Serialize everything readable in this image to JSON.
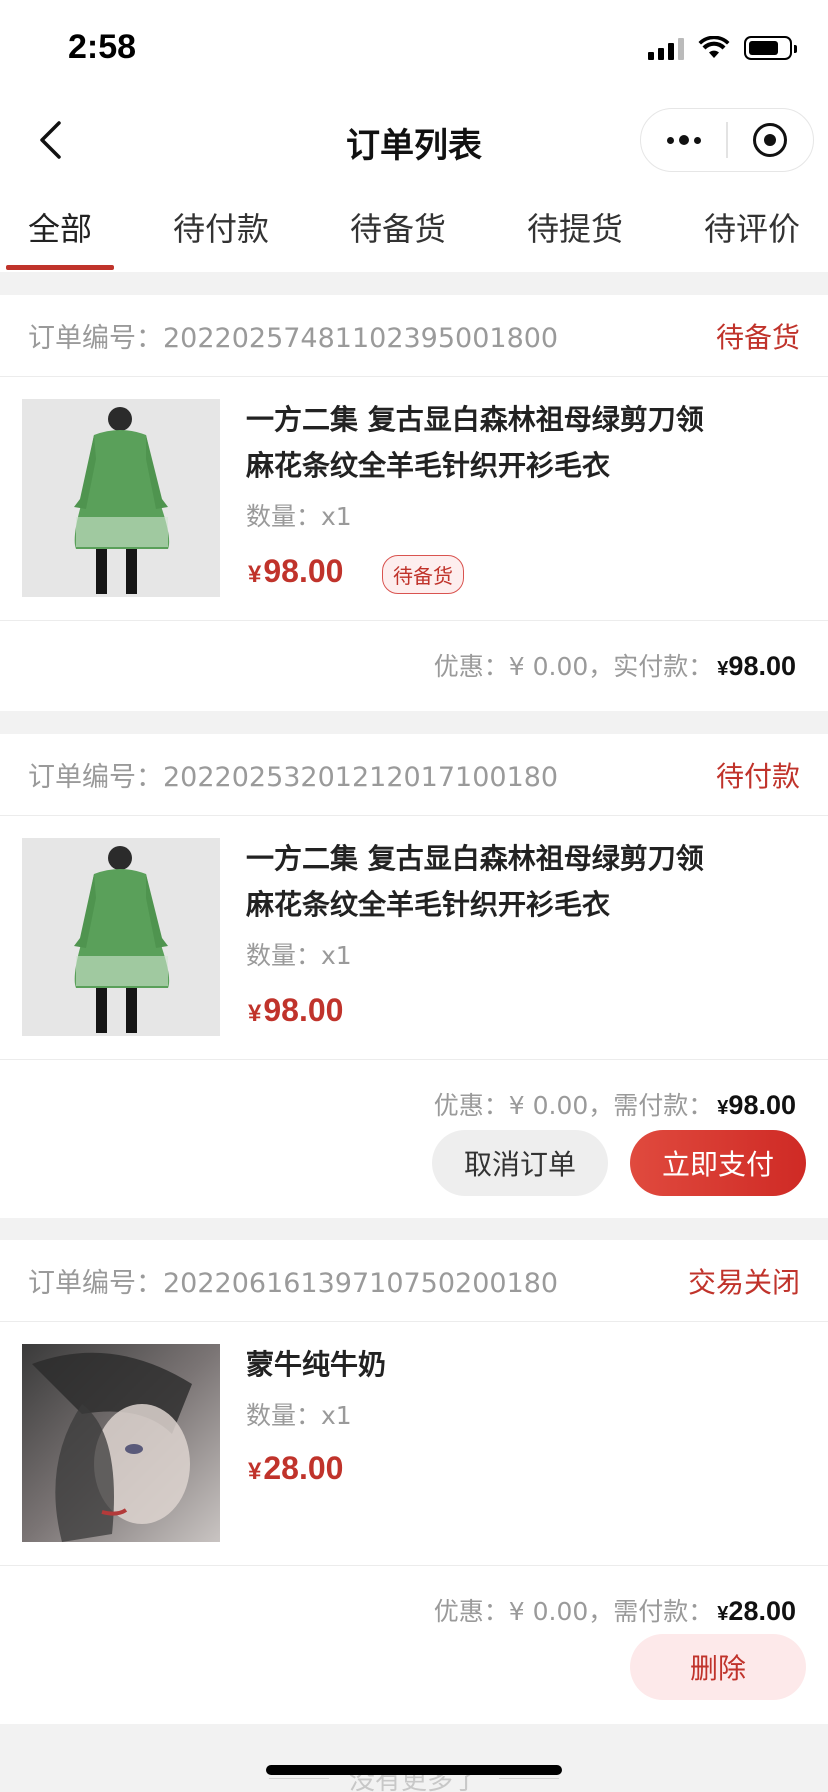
{
  "status_bar": {
    "time": "2:58",
    "battery_level": 0.7
  },
  "nav": {
    "title": "订单列表"
  },
  "tabs": [
    {
      "label": "全部",
      "active": true
    },
    {
      "label": "待付款",
      "active": false
    },
    {
      "label": "待备货",
      "active": false
    },
    {
      "label": "待提货",
      "active": false
    },
    {
      "label": "待评价",
      "active": false
    }
  ],
  "orders": [
    {
      "order_no_label": "订单编号：",
      "order_no": "20220257481102395001800",
      "status": "待备货",
      "item": {
        "title_line1": "一方二集 复古显白森林祖母绿剪刀领",
        "title_line2": "麻花条纹全羊毛针织开衫毛衣",
        "qty_label": "数量：",
        "qty": "x1",
        "currency": "¥",
        "price": "98.00",
        "badge": "待备货"
      },
      "discount_label": "优惠：",
      "discount": "¥ 0.00",
      "separator": "，",
      "pay_label": "实付款：",
      "pay_amount": "98.00"
    },
    {
      "order_no_label": "订单编号：",
      "order_no": "20220253201212017100180",
      "status": "待付款",
      "item": {
        "title_line1": "一方二集 复古显白森林祖母绿剪刀领",
        "title_line2": "麻花条纹全羊毛针织开衫毛衣",
        "qty_label": "数量：",
        "qty": "x1",
        "currency": "¥",
        "price": "98.00"
      },
      "discount_label": "优惠：",
      "discount": "¥ 0.00",
      "separator": "，",
      "pay_label": "需付款：",
      "pay_amount": "98.00",
      "buttons": {
        "cancel": "取消订单",
        "pay": "立即支付"
      }
    },
    {
      "order_no_label": "订单编号：",
      "order_no": "20220616139710750200180",
      "status": "交易关闭",
      "item": {
        "title_line1": "蒙牛纯牛奶",
        "qty_label": "数量：",
        "qty": "x1",
        "currency": "¥",
        "price": "28.00"
      },
      "discount_label": "优惠：",
      "discount": "¥ 0.00",
      "separator": "，",
      "pay_label": "需付款：",
      "pay_amount": "28.00",
      "buttons": {
        "delete": "删除"
      }
    }
  ],
  "footer": {
    "no_more": "没有更多了"
  },
  "colors": {
    "accent": "#c0332b",
    "background": "#f2f2f2"
  }
}
